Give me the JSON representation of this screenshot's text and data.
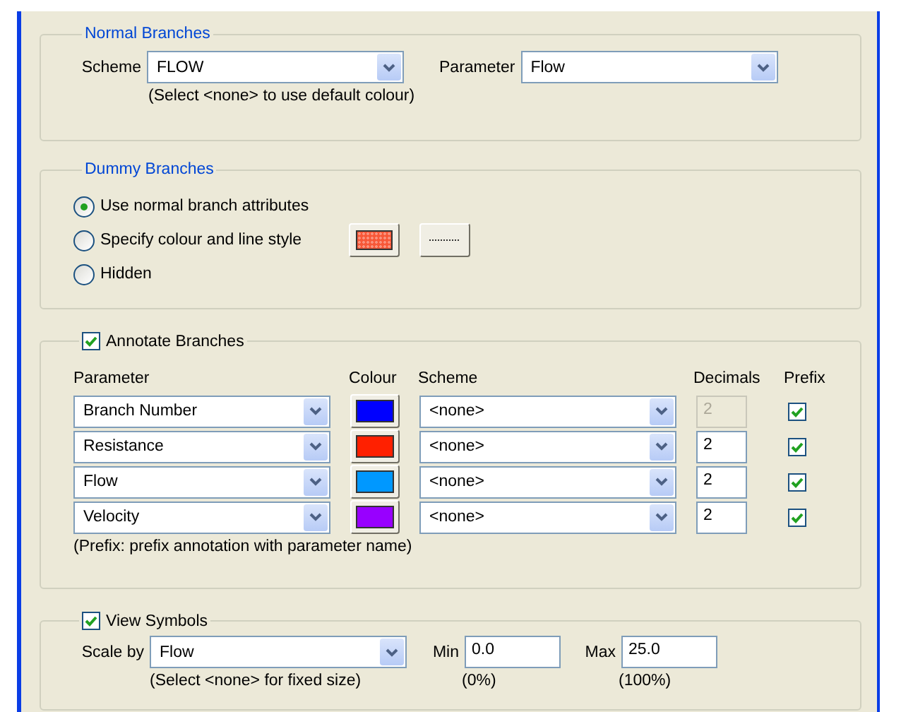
{
  "normal_branches": {
    "title": "Normal Branches",
    "scheme": {
      "label": "Scheme",
      "value": "FLOW"
    },
    "parameter": {
      "label": "Parameter",
      "value": "Flow"
    },
    "hint": "(Select <none> to use default colour)"
  },
  "dummy_branches": {
    "title": "Dummy Branches",
    "options": [
      {
        "label": "Use normal branch attributes",
        "selected": true
      },
      {
        "label": "Specify colour and line style",
        "selected": false
      },
      {
        "label": "Hidden",
        "selected": false
      }
    ],
    "color": "#f85838"
  },
  "annotate_branches": {
    "title": "Annotate Branches",
    "checked": true,
    "columns": [
      "Parameter",
      "Colour",
      "Scheme",
      "Decimals",
      "Prefix"
    ],
    "rows": [
      {
        "parameter": "Branch Number",
        "color": "#0000ff",
        "scheme": "<none>",
        "decimals": "2",
        "decimals_disabled": true,
        "prefix": true
      },
      {
        "parameter": "Resistance",
        "color": "#ff2000",
        "scheme": "<none>",
        "decimals": "2",
        "decimals_disabled": false,
        "prefix": true
      },
      {
        "parameter": "Flow",
        "color": "#0098ff",
        "scheme": "<none>",
        "decimals": "2",
        "decimals_disabled": false,
        "prefix": true
      },
      {
        "parameter": "Velocity",
        "color": "#9800ff",
        "scheme": "<none>",
        "decimals": "2",
        "decimals_disabled": false,
        "prefix": true
      }
    ],
    "note": "(Prefix:  prefix annotation with parameter name)"
  },
  "view_symbols": {
    "title": "View Symbols",
    "checked": true,
    "scale_by": {
      "label": "Scale by",
      "value": "Flow",
      "hint": "(Select <none> for fixed size)"
    },
    "min": {
      "label": "Min",
      "value": "0.0",
      "hint": "(0%)"
    },
    "max": {
      "label": "Max",
      "value": "25.0",
      "hint": "(100%)"
    }
  }
}
